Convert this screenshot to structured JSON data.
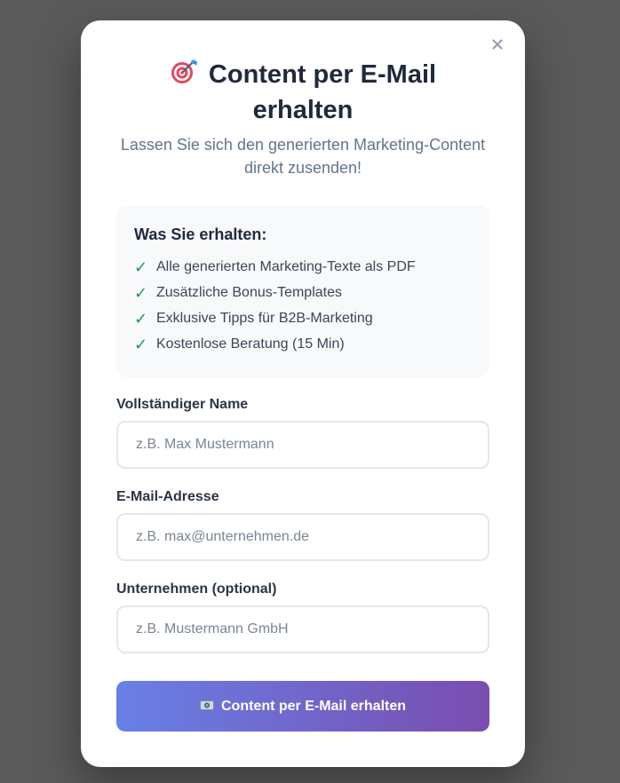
{
  "modal": {
    "title": "Content per E-Mail erhalten",
    "subtitle": "Lassen Sie sich den generierten Marketing-Content direkt zusenden!",
    "close_label": "×",
    "title_icon": "target-icon"
  },
  "benefits": {
    "title": "Was Sie erhalten:",
    "check_symbol": "✓",
    "items": [
      "Alle generierten Marketing-Texte als PDF",
      "Zusätzliche Bonus-Templates",
      "Exklusive Tipps für B2B-Marketing",
      "Kostenlose Beratung (15 Min)"
    ]
  },
  "form": {
    "name": {
      "label": "Vollständiger Name",
      "placeholder": "z.B. Max Mustermann",
      "value": ""
    },
    "email": {
      "label": "E-Mail-Adresse",
      "placeholder": "z.B. max@unternehmen.de",
      "value": ""
    },
    "company": {
      "label": "Unternehmen (optional)",
      "placeholder": "z.B. Mustermann GmbH",
      "value": ""
    },
    "submit_label": "Content per E-Mail erhalten",
    "submit_icon": "camera-icon"
  },
  "colors": {
    "overlay": "#5a5a5a",
    "title": "#1f2a3c",
    "check": "#1a9a5a",
    "button_start": "#6880e6",
    "button_end": "#7a4db0"
  }
}
